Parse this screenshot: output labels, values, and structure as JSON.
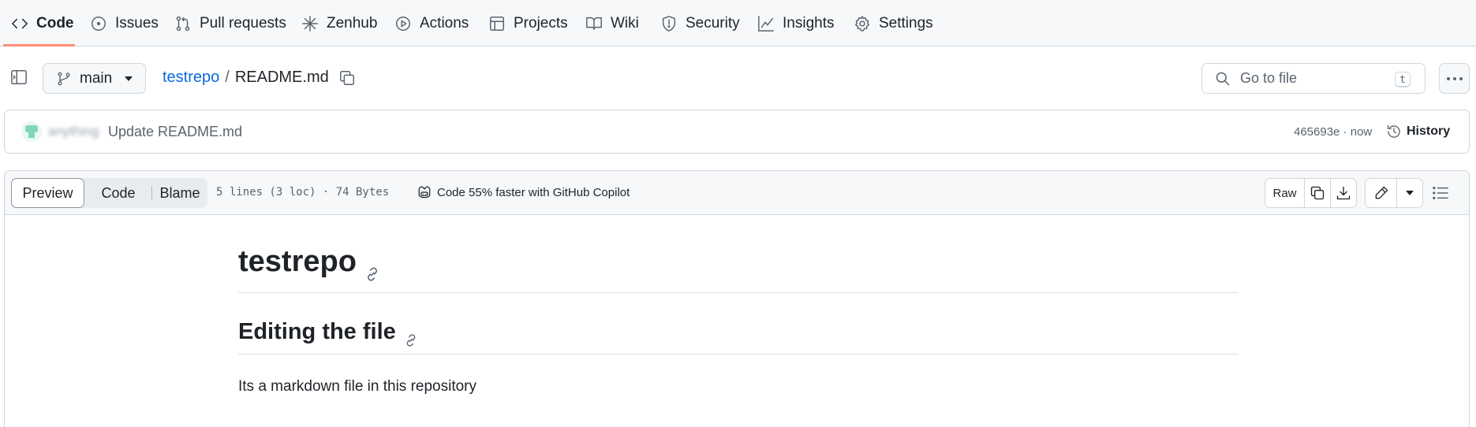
{
  "repo_nav": {
    "tabs": [
      {
        "label": "Code",
        "icon": "code-icon",
        "active": true
      },
      {
        "label": "Issues",
        "icon": "issue-opened-icon"
      },
      {
        "label": "Pull requests",
        "icon": "git-pull-request-icon"
      },
      {
        "label": "Zenhub",
        "icon": "zenhub-icon"
      },
      {
        "label": "Actions",
        "icon": "play-icon"
      },
      {
        "label": "Projects",
        "icon": "table-icon"
      },
      {
        "label": "Wiki",
        "icon": "book-icon"
      },
      {
        "label": "Security",
        "icon": "shield-icon"
      },
      {
        "label": "Insights",
        "icon": "graph-icon"
      },
      {
        "label": "Settings",
        "icon": "gear-icon"
      }
    ]
  },
  "file_header": {
    "branch": "main",
    "repo": "testrepo",
    "separator": "/",
    "file": "README.md",
    "goto_placeholder": "Go to file",
    "goto_shortcut": "t"
  },
  "commit": {
    "author": "anything",
    "message": "Update README.md",
    "meta": "465693e · now",
    "history_label": "History"
  },
  "file_toolbar": {
    "views": [
      "Preview",
      "Code",
      "Blame"
    ],
    "active_view": "Preview",
    "info": "5 lines (3 loc) · 74 Bytes",
    "copilot": "Code 55% faster with GitHub Copilot",
    "raw_label": "Raw"
  },
  "markdown": {
    "h1": "testrepo",
    "h2": "Editing the file",
    "paragraph": "Its a markdown file in this repository"
  },
  "colors": {
    "accent_link": "#0969da",
    "tab_underline": "#fd8c73",
    "border": "#d0d7de",
    "muted_text": "#59636e"
  }
}
